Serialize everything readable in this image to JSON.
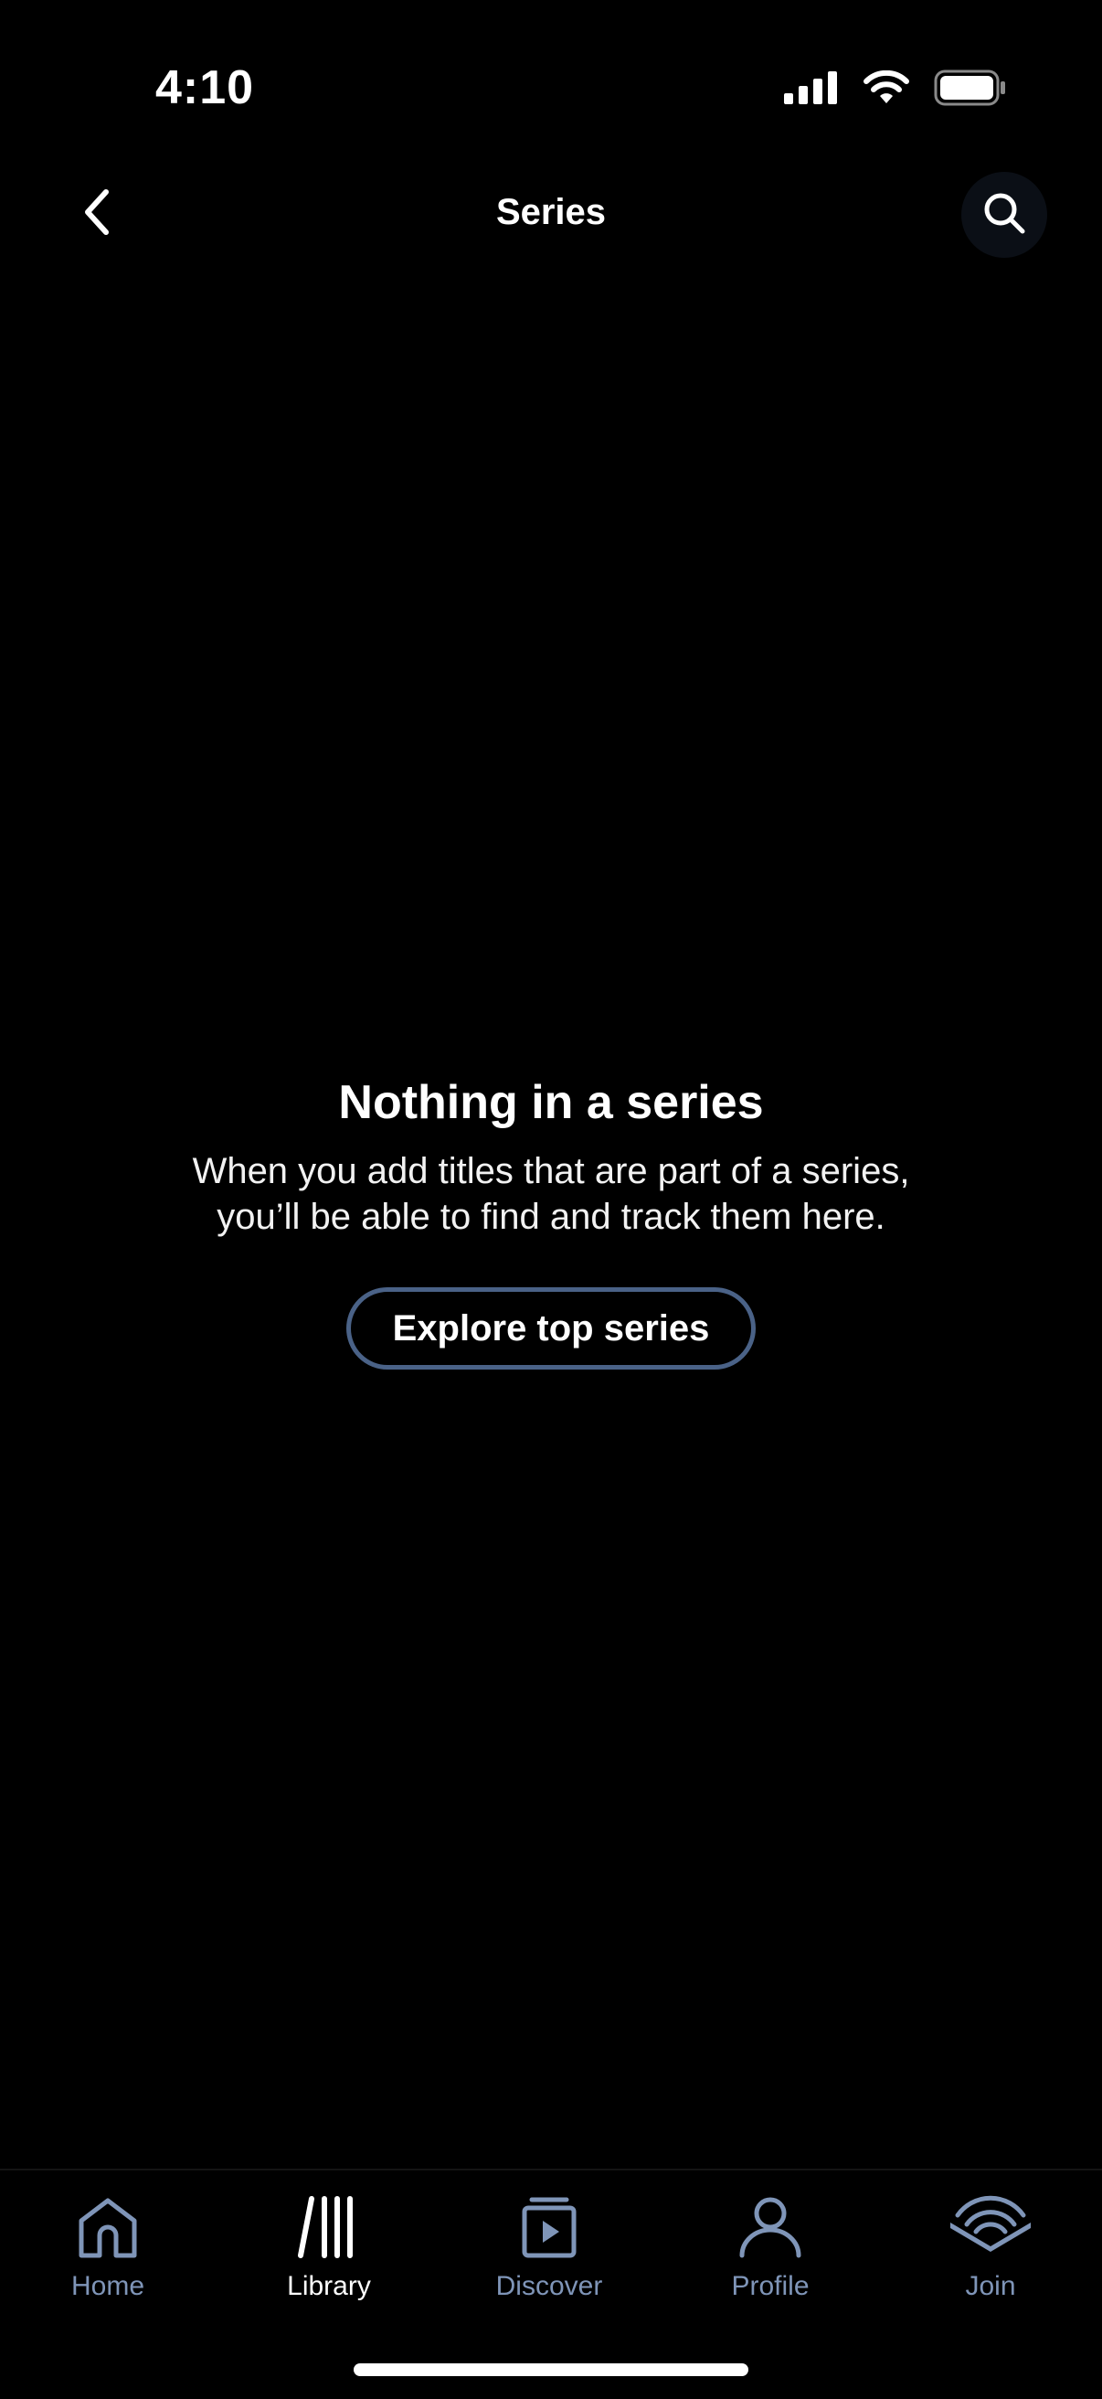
{
  "status_bar": {
    "time": "4:10"
  },
  "header": {
    "title": "Series",
    "back_icon": "chevron-left-icon",
    "search_icon": "search-icon"
  },
  "empty_state": {
    "title": "Nothing in a series",
    "description_line1": "When you add titles that are part of a series,",
    "description_line2": "you’ll be able to find and track them here.",
    "button_label": "Explore top series"
  },
  "tab_bar": {
    "items": [
      {
        "label": "Home",
        "icon": "home-icon",
        "active": false
      },
      {
        "label": "Library",
        "icon": "library-icon",
        "active": true
      },
      {
        "label": "Discover",
        "icon": "discover-icon",
        "active": false
      },
      {
        "label": "Profile",
        "icon": "profile-icon",
        "active": false
      },
      {
        "label": "Join",
        "icon": "join-icon",
        "active": false
      }
    ]
  },
  "colors": {
    "background": "#000000",
    "accent": "#7f95b8",
    "button_border": "#4a6287",
    "text": "#ffffff"
  }
}
